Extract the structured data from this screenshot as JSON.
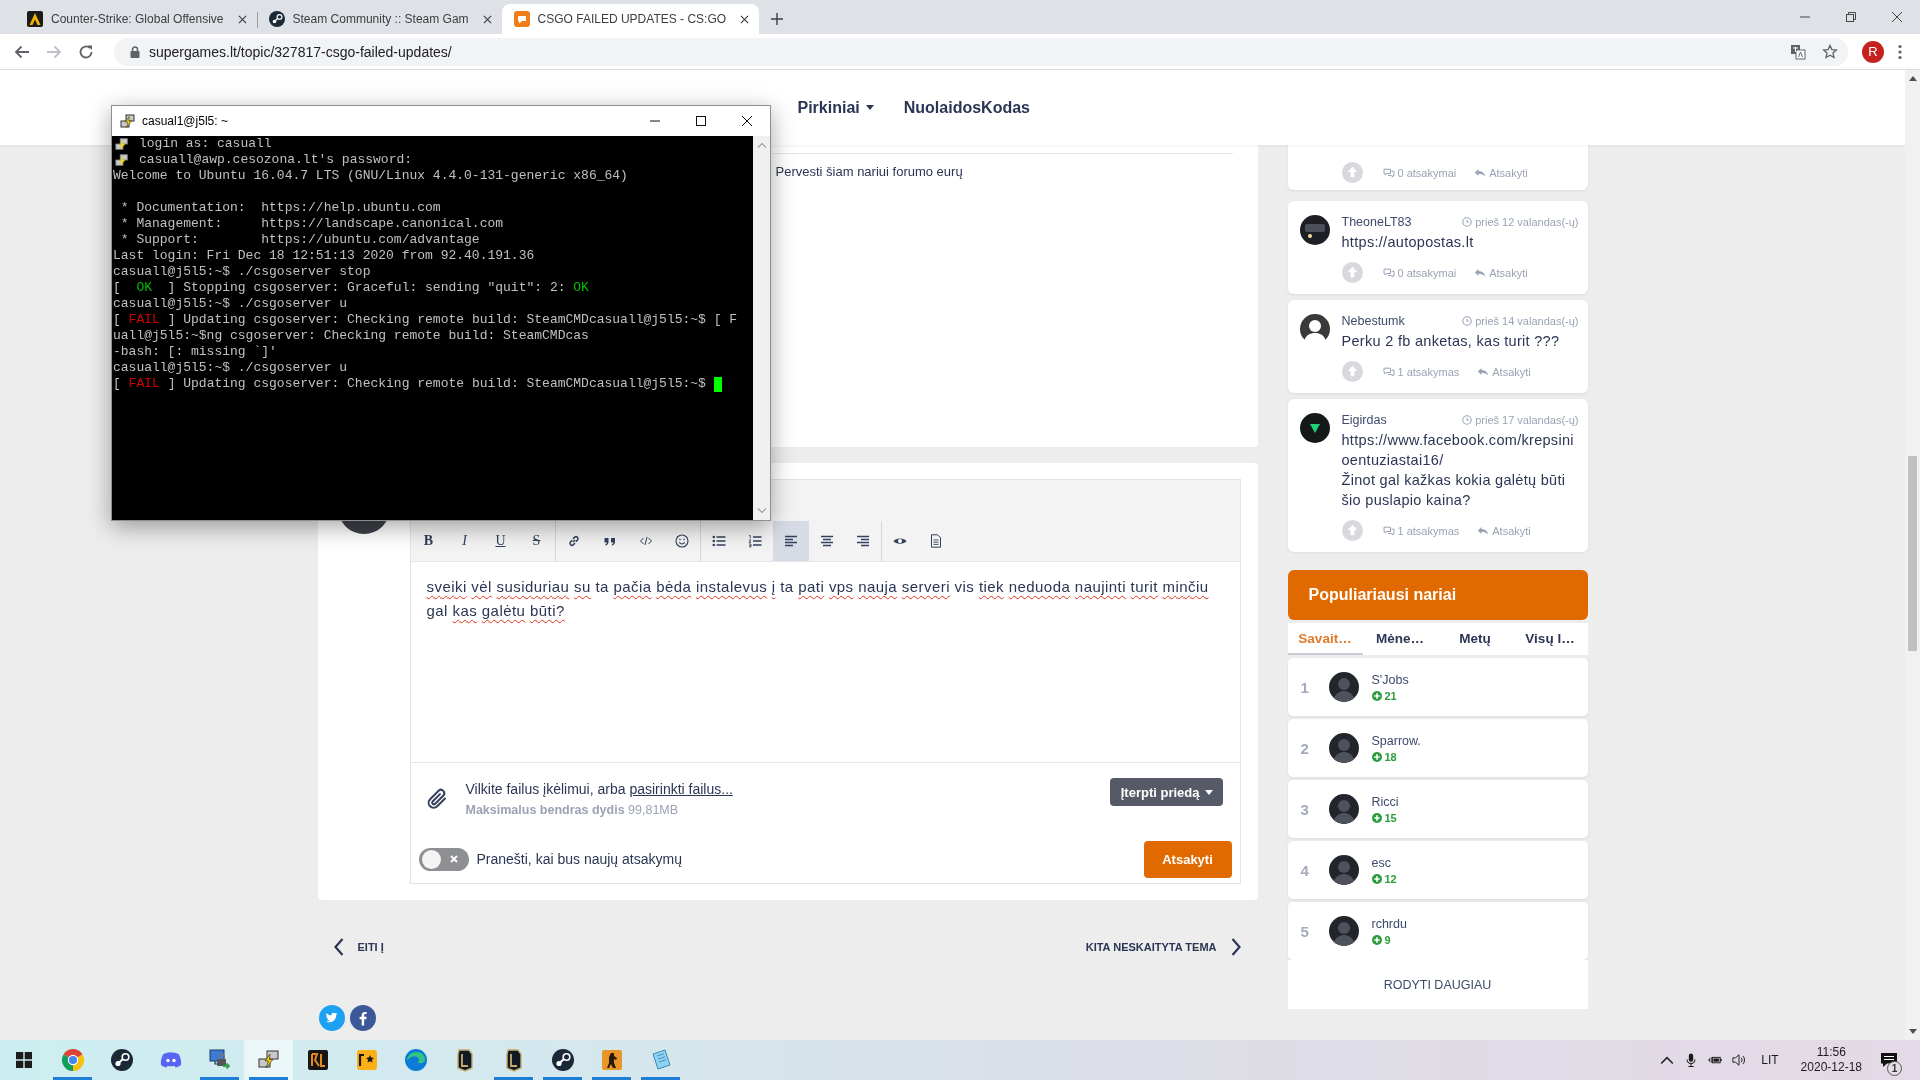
{
  "browser": {
    "tabs": [
      {
        "kind": "game",
        "title": "Counter-Strike: Global Offensive",
        "selected": false
      },
      {
        "kind": "steam",
        "title": "Steam Community :: Steam Gam",
        "selected": false
      },
      {
        "kind": "forum",
        "title": "CSGO FAILED UPDATES - CS:GO",
        "selected": true
      }
    ],
    "url": "supergames.lt/topic/327817-csgo-failed-updates/",
    "profile_initial": "R"
  },
  "site_nav": [
    {
      "label": "Pirkiniai",
      "dropdown": true
    },
    {
      "label": "NuolaidosKodas",
      "dropdown": false
    }
  ],
  "terminal": {
    "title": "casual1@j5l5: ~",
    "cursor": true,
    "lines": [
      {
        "kind": "notice",
        "parts": [
          {
            "kind": "plain",
            "text": "login as: casuall"
          }
        ]
      },
      {
        "kind": "notice",
        "parts": [
          {
            "kind": "plain",
            "text": "casuall@awp.cesozona.lt's password:"
          }
        ]
      },
      {
        "kind": "text",
        "parts": [
          {
            "kind": "plain",
            "text": "Welcome to Ubuntu 16.04.7 LTS (GNU/Linux 4.4.0-131-generic x86_64)"
          }
        ]
      },
      {
        "kind": "blank"
      },
      {
        "kind": "text",
        "parts": [
          {
            "kind": "plain",
            "text": " * Documentation:  https://help.ubuntu.com"
          }
        ]
      },
      {
        "kind": "text",
        "parts": [
          {
            "kind": "plain",
            "text": " * Management:     https://landscape.canonical.com"
          }
        ]
      },
      {
        "kind": "text",
        "parts": [
          {
            "kind": "plain",
            "text": " * Support:        https://ubuntu.com/advantage"
          }
        ]
      },
      {
        "kind": "text",
        "parts": [
          {
            "kind": "plain",
            "text": "Last login: Fri Dec 18 12:51:13 2020 from 92.40.191.36"
          }
        ]
      },
      {
        "kind": "text",
        "parts": [
          {
            "kind": "plain",
            "text": "casuall@j5l5:~$ ./csgoserver stop"
          }
        ]
      },
      {
        "kind": "text",
        "parts": [
          {
            "kind": "plain",
            "text": "[  "
          },
          {
            "kind": "ok",
            "text": "OK"
          },
          {
            "kind": "plain",
            "text": "  ] Stopping csgoserver: Graceful: sending \"quit\": 2: "
          },
          {
            "kind": "ok",
            "text": "OK"
          }
        ]
      },
      {
        "kind": "text",
        "parts": [
          {
            "kind": "plain",
            "text": "casuall@j5l5:~$ ./csgoserver u"
          }
        ]
      },
      {
        "kind": "text",
        "parts": [
          {
            "kind": "plain",
            "text": "[ "
          },
          {
            "kind": "fail",
            "text": "FAIL"
          },
          {
            "kind": "plain",
            "text": " ] Updating csgoserver: Checking remote build: SteamCMDcasuall@j5l5:~$ [ F"
          }
        ]
      },
      {
        "kind": "text",
        "parts": [
          {
            "kind": "plain",
            "text": "uall@j5l5:~$ng csgoserver: Checking remote build: SteamCMDcas"
          }
        ]
      },
      {
        "kind": "text",
        "parts": [
          {
            "kind": "plain",
            "text": "-bash: [: missing `]'"
          }
        ]
      },
      {
        "kind": "text",
        "parts": [
          {
            "kind": "plain",
            "text": "casuall@j5l5:~$ ./csgoserver u"
          }
        ]
      },
      {
        "kind": "text",
        "parts": [
          {
            "kind": "plain",
            "text": "[ "
          },
          {
            "kind": "fail",
            "text": "FAIL"
          },
          {
            "kind": "plain",
            "text": " ] Updating csgoserver: Checking remote build: SteamCMDcasuall@j5l5:~$ "
          }
        ]
      }
    ]
  },
  "post": {
    "transfer_link": "Pervesti šiam nariui forumo eurų"
  },
  "reply_editor": {
    "toolbar": [
      [
        {
          "kind": "bold",
          "label": "B",
          "active": false
        },
        {
          "kind": "italic",
          "label": "I",
          "active": false
        },
        {
          "kind": "underline",
          "label": "U",
          "active": false
        },
        {
          "kind": "strike",
          "label": "S",
          "active": false
        }
      ],
      [
        {
          "kind": "link",
          "active": false
        },
        {
          "kind": "quote",
          "active": false
        },
        {
          "kind": "code",
          "active": false
        },
        {
          "kind": "emoji",
          "active": false
        }
      ],
      [
        {
          "kind": "bullets",
          "active": false
        },
        {
          "kind": "numbers",
          "active": false
        },
        {
          "kind": "left",
          "active": true
        },
        {
          "kind": "center",
          "active": false
        },
        {
          "kind": "right",
          "active": false
        }
      ],
      [
        {
          "kind": "preview",
          "active": false
        },
        {
          "kind": "source",
          "active": false
        }
      ]
    ],
    "words": [
      {
        "text": "sveiki",
        "misspelled": true
      },
      {
        "text": "vėl",
        "misspelled": true
      },
      {
        "text": "susiduriau",
        "misspelled": true
      },
      {
        "text": "su",
        "misspelled": true
      },
      {
        "text": "ta",
        "misspelled": false
      },
      {
        "text": "pačia",
        "misspelled": true
      },
      {
        "text": "bėda",
        "misspelled": true
      },
      {
        "text": "instalevus",
        "misspelled": true
      },
      {
        "text": "į",
        "misspelled": true
      },
      {
        "text": "ta",
        "misspelled": false
      },
      {
        "text": "pati",
        "misspelled": true
      },
      {
        "text": "vps",
        "misspelled": true
      },
      {
        "text": "nauja",
        "misspelled": true
      },
      {
        "text": "serveri",
        "misspelled": true
      },
      {
        "text": "vis",
        "misspelled": false
      },
      {
        "text": "tiek",
        "misspelled": true
      },
      {
        "text": "neduoda",
        "misspelled": true
      },
      {
        "text": "naujinti",
        "misspelled": true
      },
      {
        "text": "turit",
        "misspelled": true
      },
      {
        "text": "minčiu",
        "misspelled": true
      },
      {
        "text": "gal",
        "misspelled": false
      },
      {
        "text": "kas",
        "misspelled": true
      },
      {
        "text": "galėtu",
        "misspelled": true
      },
      {
        "text": "būti?",
        "misspelled": true
      }
    ],
    "attach_text": "Vilkite failus įkėlimui, arba",
    "attach_link": "pasirinkti failus...",
    "size_limit": "**Maksimalus bendras dydis** 99,81MB",
    "attach_button": "Įterpti priedą",
    "notify": {
      "label": "Pranešti, kai bus naujų atsakymų",
      "on": false
    },
    "submit": "Atsakyti"
  },
  "topic_nav": {
    "previous": "EITI Į",
    "next": "KITA NESKAITYTA TEMA"
  },
  "share": [
    {
      "kind": "twitter"
    },
    {
      "kind": "facebook"
    }
  ],
  "shoutbox": [
    {
      "replies": "0 atsakymai",
      "reply": "Atsakyti"
    },
    {
      "author": "TheoneLT83",
      "avatar": {
        "kind": "photo"
      },
      "time": "prieš 12 valandas(-ų)",
      "message_lines": [
        "https://autopostas.lt"
      ],
      "replies": "0 atsakymai",
      "reply": "Atsakyti"
    },
    {
      "author": "Nebestumk",
      "avatar": {
        "kind": "silhouette"
      },
      "time": "prieš 14 valandas(-ų)",
      "message_lines": [
        "Perku 2 fb anketas, kas turit ???"
      ],
      "replies": "1 atsakymas",
      "reply": "Atsakyti"
    },
    {
      "author": "Eigirdas",
      "avatar": {
        "kind": "logo"
      },
      "time": "prieš 17 valandas(-ų)",
      "message_lines": [
        "https://www.facebook.com/krepsinioentuziastai16/",
        "Žinot gal kažkas kokia galėtų būti šio puslapio kaina?"
      ],
      "replies": "1 atsakymas",
      "reply": "Atsakyti"
    }
  ],
  "popular": {
    "title": "Populiariausi nariai",
    "tabs": [
      {
        "label": "Savait…",
        "selected": true
      },
      {
        "label": "Mėne…",
        "selected": false
      },
      {
        "label": "Metų",
        "selected": false
      },
      {
        "label": "Visų l…",
        "selected": false
      }
    ],
    "members": [
      {
        "rank": "1",
        "name": "S'Jobs",
        "points": "21"
      },
      {
        "rank": "2",
        "name": "Sparrow.",
        "points": "18"
      },
      {
        "rank": "3",
        "name": "Ricci",
        "points": "15"
      },
      {
        "rank": "4",
        "name": "esc",
        "points": "12"
      },
      {
        "rank": "5",
        "name": "rchrdu",
        "points": "9"
      }
    ],
    "more": "RODYTI DAUGIAU"
  },
  "taskbar": {
    "apps": [
      {
        "kind": "chrome",
        "running": true,
        "active": false
      },
      {
        "kind": "steam",
        "running": false,
        "active": false
      },
      {
        "kind": "discord",
        "running": false,
        "active": false
      },
      {
        "kind": "network",
        "running": true,
        "active": false
      },
      {
        "kind": "putty",
        "running": true,
        "active": true
      },
      {
        "kind": "rl",
        "running": false,
        "active": false
      },
      {
        "kind": "rockstar",
        "running": false,
        "active": false
      },
      {
        "kind": "edge",
        "running": false,
        "active": false
      },
      {
        "kind": "league",
        "running": false,
        "active": false
      },
      {
        "kind": "league",
        "running": true,
        "active": false
      },
      {
        "kind": "steam",
        "running": true,
        "active": false
      },
      {
        "kind": "csgo",
        "running": true,
        "active": false
      },
      {
        "kind": "notes",
        "running": true,
        "active": false
      }
    ],
    "language": "LIT",
    "time": "11:56",
    "date": "2020-12-18",
    "notification_count": "1"
  }
}
